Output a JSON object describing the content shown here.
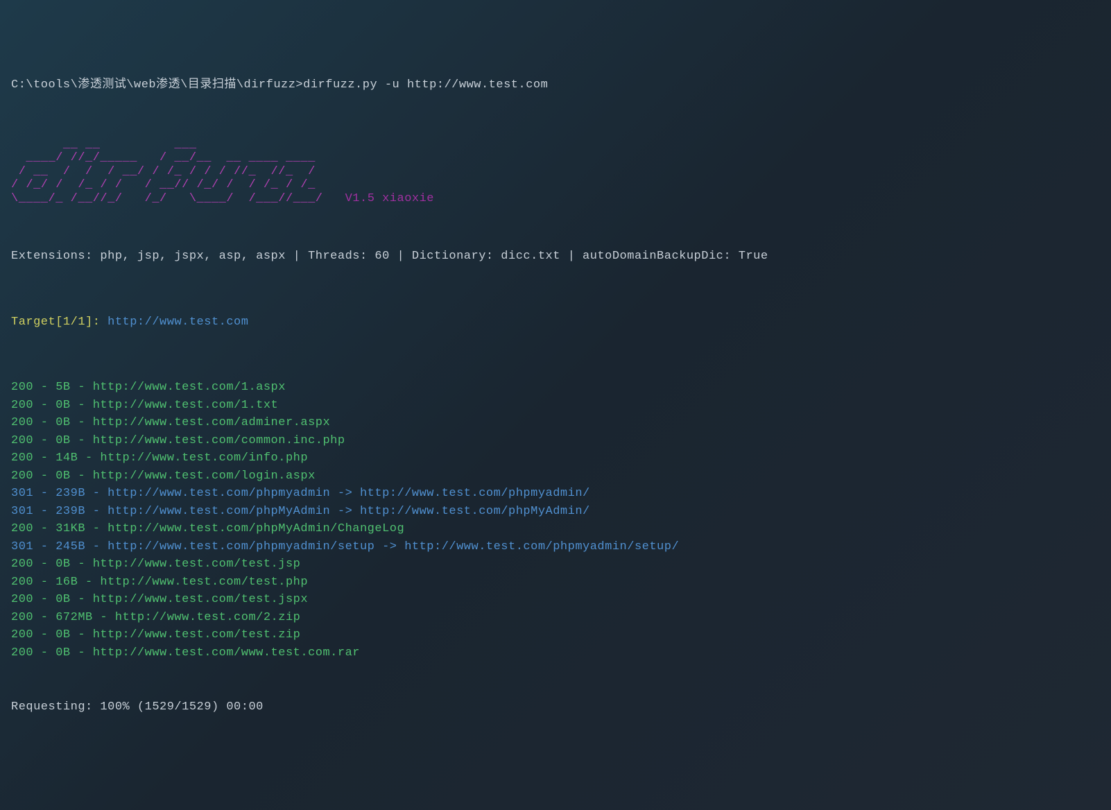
{
  "prompt": "C:\\tools\\渗透测试\\web渗透\\目录扫描\\dirfuzz>dirfuzz.py -u http://www.test.com",
  "ascii_lines": [
    "       __ __          ___",
    "  ____/ //_/_____   / __/__  __ ____ ____",
    " / __  /  /  / __/ / /_ / / / //_  //_  /",
    "/ /_/ /  /_ / /   / __// /_/ /  / /_ / /_",
    "\\____/_ /__//_/   /_/   \\____/  /___//___/"
  ],
  "version": "V1.5 xiaoxie",
  "info": "Extensions: php, jsp, jspx, asp, aspx | Threads: 60 | Dictionary: dicc.txt | autoDomainBackupDic: True",
  "target_label": "Target[1/1]: ",
  "target_url": "http://www.test.com",
  "results": [
    {
      "status": "200",
      "size": "5B",
      "url": "http://www.test.com/1.aspx",
      "redirect": null
    },
    {
      "status": "200",
      "size": "0B",
      "url": "http://www.test.com/1.txt",
      "redirect": null
    },
    {
      "status": "200",
      "size": "0B",
      "url": "http://www.test.com/adminer.aspx",
      "redirect": null
    },
    {
      "status": "200",
      "size": "0B",
      "url": "http://www.test.com/common.inc.php",
      "redirect": null
    },
    {
      "status": "200",
      "size": "14B",
      "url": "http://www.test.com/info.php",
      "redirect": null
    },
    {
      "status": "200",
      "size": "0B",
      "url": "http://www.test.com/login.aspx",
      "redirect": null
    },
    {
      "status": "301",
      "size": "239B",
      "url": "http://www.test.com/phpmyadmin",
      "redirect": "http://www.test.com/phpmyadmin/"
    },
    {
      "status": "301",
      "size": "239B",
      "url": "http://www.test.com/phpMyAdmin",
      "redirect": "http://www.test.com/phpMyAdmin/"
    },
    {
      "status": "200",
      "size": "31KB",
      "url": "http://www.test.com/phpMyAdmin/ChangeLog",
      "redirect": null
    },
    {
      "status": "301",
      "size": "245B",
      "url": "http://www.test.com/phpmyadmin/setup",
      "redirect": "http://www.test.com/phpmyadmin/setup/"
    },
    {
      "status": "200",
      "size": "0B",
      "url": "http://www.test.com/test.jsp",
      "redirect": null
    },
    {
      "status": "200",
      "size": "16B",
      "url": "http://www.test.com/test.php",
      "redirect": null
    },
    {
      "status": "200",
      "size": "0B",
      "url": "http://www.test.com/test.jspx",
      "redirect": null
    },
    {
      "status": "200",
      "size": "672MB",
      "url": "http://www.test.com/2.zip",
      "redirect": null
    },
    {
      "status": "200",
      "size": "0B",
      "url": "http://www.test.com/test.zip",
      "redirect": null
    },
    {
      "status": "200",
      "size": "0B",
      "url": "http://www.test.com/www.test.com.rar",
      "redirect": null
    }
  ],
  "requesting": "Requesting: 100% (1529/1529) 00:00"
}
